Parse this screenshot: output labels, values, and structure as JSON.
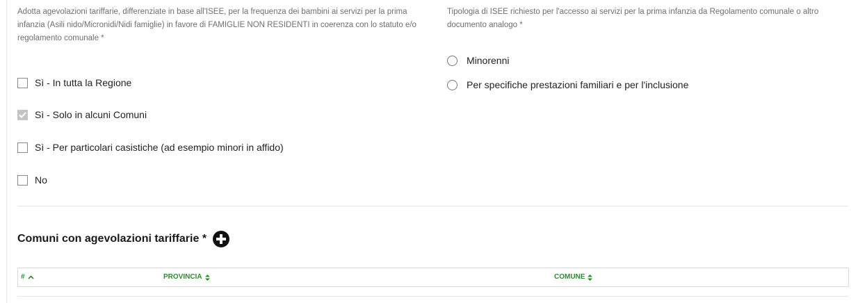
{
  "form": {
    "question_left": "Adotta agevolazioni tariffarie, differenziate in base all'ISEE, per la frequenza dei bambini ai servizi per la prima infanzia (Asili nido/Micronidi/Nidi famiglie) in favore di FAMIGLIE NON RESIDENTI in coerenza con lo statuto e/o regolamento comunale *",
    "checkbox_options": [
      {
        "label": "Sì - In tutta la Regione",
        "checked": false
      },
      {
        "label": "Sì - Solo in alcuni Comuni",
        "checked": true
      },
      {
        "label": "Sì - Per particolari casistiche (ad esempio minori in affido)",
        "checked": false
      },
      {
        "label": "No",
        "checked": false
      }
    ],
    "question_right": "Tipologia di ISEE richiesto per l'accesso ai servizi per la prima infanzia da Regolamento comunale o altro documento analogo *",
    "radio_options": [
      {
        "label": "Minorenni",
        "selected": false
      },
      {
        "label": "Per specifiche prestazioni familiari e per l'inclusione",
        "selected": false
      }
    ]
  },
  "section": {
    "title": "Comuni con agevolazioni tariffarie *",
    "add_icon": "plus-circle-icon"
  },
  "table": {
    "columns": [
      {
        "label": "#",
        "sort": "ascending",
        "icon": "caret-up-icon"
      },
      {
        "label": "PROVINCIA",
        "sort": "both",
        "icon": "sort-icon"
      },
      {
        "label": "COMUNE",
        "sort": "both",
        "icon": "sort-icon"
      }
    ],
    "rows": []
  },
  "colors": {
    "header_text": "#2e8b2e",
    "muted_text": "#6f6f6f",
    "checked_box": "#c4c4c4"
  }
}
